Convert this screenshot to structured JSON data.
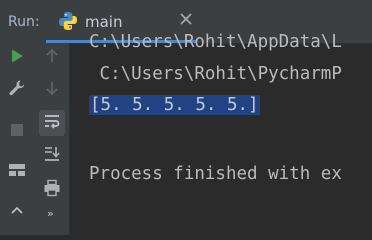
{
  "run_panel": {
    "label": "Run:",
    "tab": {
      "title": "main",
      "icon": "python-icon"
    }
  },
  "toolbar_left": [
    {
      "icon": "run-icon"
    },
    {
      "icon": "wrench-icon"
    },
    {
      "icon": "stop-icon"
    },
    {
      "icon": "layout-icon"
    },
    {
      "icon": "pin-icon"
    }
  ],
  "toolbar_right": [
    {
      "icon": "up-arrow-icon"
    },
    {
      "icon": "down-arrow-icon"
    },
    {
      "icon": "soft-wrap-icon",
      "active": true
    },
    {
      "icon": "scroll-to-end-icon"
    },
    {
      "icon": "print-icon"
    },
    {
      "icon": "more-icon",
      "glyph": "»"
    }
  ],
  "console": {
    "lines": [
      "C:\\Users\\Rohit\\AppData\\L",
      " C:\\Users\\Rohit\\PycharmP",
      "[5. 5. 5. 5. 5.]",
      "",
      "Process finished with ex"
    ]
  },
  "colors": {
    "background": "#2b2b2b",
    "panel": "#3c3f41",
    "selection": "#214283",
    "accent": "#4a88c7",
    "run_green": "#499c54"
  }
}
